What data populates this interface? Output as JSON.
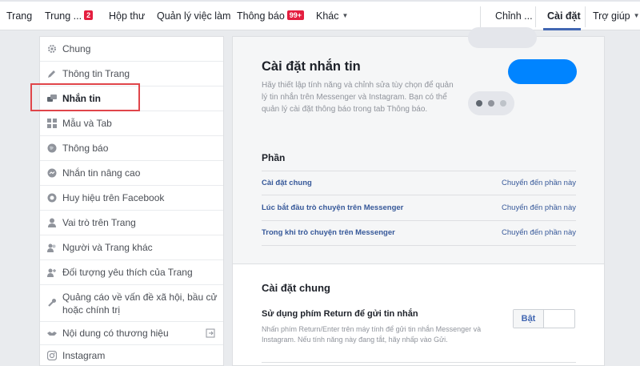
{
  "topnav": {
    "items": [
      {
        "label": "Trang"
      },
      {
        "label": "Trung ...",
        "badge": "2"
      },
      {
        "label": "Hộp thư"
      },
      {
        "label": "Quản lý việc làm"
      },
      {
        "label": "Thông báo",
        "badge": "99+"
      },
      {
        "label": "Khác"
      }
    ],
    "right": [
      {
        "label": "Chỉnh ..."
      },
      {
        "label": "Cài đặt",
        "active": true
      },
      {
        "label": "Trợ giúp"
      }
    ],
    "accent": "#4267b2",
    "badge_color": "#e41e3f"
  },
  "sidebar": {
    "items": [
      {
        "label": "Chung",
        "icon": "gear-icon"
      },
      {
        "label": "Thông tin Trang",
        "icon": "pencil-icon"
      },
      {
        "label": "Nhắn tin",
        "icon": "chat-bubbles-icon",
        "active": true
      },
      {
        "label": "Mẫu và Tab",
        "icon": "grid-icon"
      },
      {
        "label": "Thông báo",
        "icon": "globe-icon"
      },
      {
        "label": "Nhắn tin nâng cao",
        "icon": "messenger-icon"
      },
      {
        "label": "Huy hiệu trên Facebook",
        "icon": "badge-icon"
      },
      {
        "label": "Vai trò trên Trang",
        "icon": "person-icon"
      },
      {
        "label": "Người và Trang khác",
        "icon": "people-icon"
      },
      {
        "label": "Đối tượng yêu thích của Trang",
        "icon": "people-plus-icon"
      },
      {
        "label": "Quảng cáo về vấn đề xã hội, bầu cử hoặc chính trị",
        "icon": "wrench-icon"
      },
      {
        "label": "Nội dung có thương hiệu",
        "icon": "handshake-icon"
      },
      {
        "label": "Instagram",
        "icon": "instagram-icon"
      }
    ]
  },
  "main": {
    "intro": {
      "title": "Cài đặt nhắn tin",
      "description": "Hãy thiết lập tính năng và chỉnh sửa tùy chọn để quản lý tin nhắn trên Messenger và Instagram. Bạn có thể quản lý cài đặt thông báo trong tab Thông báo."
    },
    "sections_heading": "Phần",
    "sections": [
      {
        "label": "Cài đặt chung",
        "link": "Chuyển đến phần này"
      },
      {
        "label": "Lúc bắt đầu trò chuyện trên Messenger",
        "link": "Chuyển đến phần này"
      },
      {
        "label": "Trong khi trò chuyện trên Messenger",
        "link": "Chuyển đến phần này"
      }
    ],
    "general": {
      "title": "Cài đặt chung",
      "option_title": "Sử dụng phím Return để gửi tin nhắn",
      "option_desc": "Nhấn phím Return/Enter trên máy tính để gửi tin nhắn Messenger và Instagram. Nếu tính năng này đang tắt, hãy nhấp vào Gửi.",
      "toggle_on_label": "Bật"
    },
    "messenger_blue": "#0084ff"
  }
}
